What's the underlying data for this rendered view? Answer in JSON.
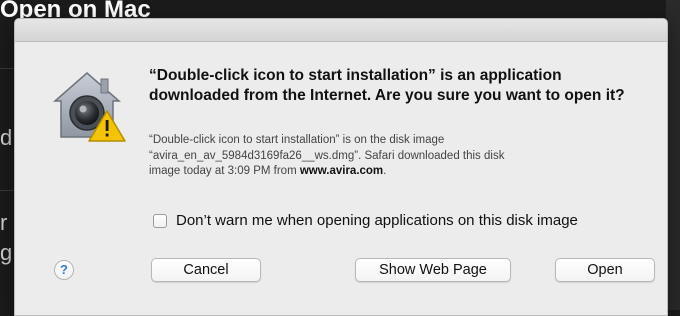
{
  "background": {
    "heading": "Open on Mac",
    "stubs": [
      "d",
      "r",
      "g"
    ]
  },
  "dialog": {
    "title": "“Double-click icon to start installation” is an application downloaded from the Internet. Are you sure you want to open it?",
    "info": {
      "line1": "“Double-click icon to start installation” is on the disk image",
      "line2": "“avira_en_av_5984d3169fa26__ws.dmg”. Safari downloaded this disk",
      "line3_prefix": "image today at 3:09 PM from ",
      "source": "www.avira.com",
      "line3_suffix": "."
    },
    "checkbox": {
      "label": "Don’t warn me when opening applications on this disk image",
      "checked": false
    },
    "help_label": "?",
    "buttons": {
      "cancel": "Cancel",
      "show_web_page": "Show Web Page",
      "open": "Open"
    },
    "icon": "gatekeeper-warning-icon"
  },
  "colors": {
    "dialog_bg": "#ececec",
    "help_blue": "#2f7de1",
    "warning_yellow": "#f5c400"
  }
}
